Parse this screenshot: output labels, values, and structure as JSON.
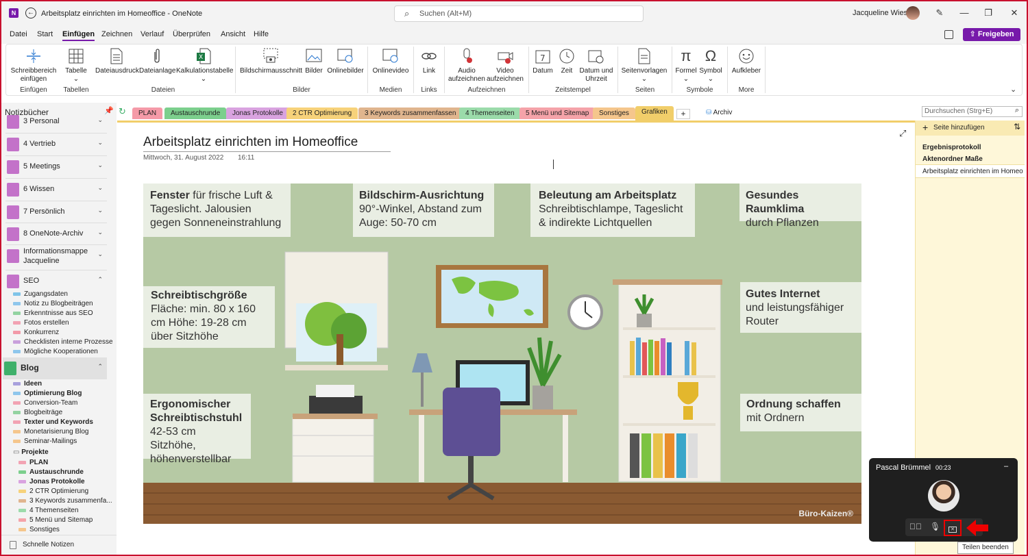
{
  "window": {
    "title": "Arbeitsplatz einrichten im Homeoffice - OneNote",
    "app_icon": "onenote-icon",
    "back_icon": "back-arrow-icon"
  },
  "search": {
    "placeholder": "Suchen (Alt+M)"
  },
  "user": {
    "name": "Jacqueline Wiese"
  },
  "menu": [
    "Datei",
    "Start",
    "Einfügen",
    "Zeichnen",
    "Verlauf",
    "Überprüfen",
    "Ansicht",
    "Hilfe"
  ],
  "menu_active": "Einfügen",
  "share_label": "Freigeben",
  "ribbon": {
    "buttons": [
      "Schreibbereich einfügen",
      "Tabelle",
      "Dateiausdruck",
      "Dateianlage",
      "Kalkulationstabelle",
      "Bildschirmausschnitt",
      "Bilder",
      "Onlinebilder",
      "Onlinevideo",
      "Link",
      "Audio aufzeichnen",
      "Video aufzeichnen",
      "Datum",
      "Zeit",
      "Datum und Uhrzeit",
      "Seitenvorlagen",
      "Formel",
      "Symbol",
      "Aufkleber"
    ],
    "groups": [
      "Einfügen",
      "Tabellen",
      "Dateien",
      "Bilder",
      "Medien",
      "Links",
      "Aufzeichnen",
      "Zeitstempel",
      "Seiten",
      "Symbole",
      "More"
    ]
  },
  "nav": {
    "header": "Notizbücher",
    "notebooks": [
      "3 Personal",
      "4 Vertrieb",
      "5 Meetings",
      "6 Wissen",
      "7 Persönlich",
      "8 OneNote-Archiv",
      "Informationsmappe Jacqueline",
      "SEO"
    ],
    "seo_sections": [
      "Zugangsdaten",
      "Notiz zu Blogbeiträgen",
      "Erkenntnisse aus SEO",
      "Fotos erstellen",
      "Konkurrenz",
      "Checklisten interne Prozesse",
      "Mögliche Kooperationen"
    ],
    "blog": "Blog",
    "blog_sections": [
      "Ideen",
      "Optimierung Blog",
      "Conversion-Team",
      "Blogbeiträge",
      "Texter und Keywords",
      "Monetarisierung Blog",
      "Seminar-Mailings"
    ],
    "projekte": "Projekte",
    "projekte_sections": [
      "PLAN",
      "Austauschrunde",
      "Jonas Protokolle",
      "2 CTR Optimierung",
      "3 Keywords zusammenfa...",
      "4 Themenseiten",
      "5 Menü und Sitemap",
      "Sonstiges"
    ],
    "quick_notes": "Schnelle Notizen"
  },
  "tabs": [
    {
      "label": "PLAN",
      "color": "#f59aa8"
    },
    {
      "label": "Austauschrunde",
      "color": "#7ccf8d"
    },
    {
      "label": "Jonas Protokolle",
      "color": "#d9a3e0"
    },
    {
      "label": "2 CTR Optimierung",
      "color": "#f7d27a"
    },
    {
      "label": "3 Keywords zusammenfassen",
      "color": "#e0b58e"
    },
    {
      "label": "4 Themenseiten",
      "color": "#9bdbaa"
    },
    {
      "label": "5 Menü und Sitemap",
      "color": "#f5a3a9"
    },
    {
      "label": "Sonstiges",
      "color": "#f5c68c"
    },
    {
      "label": "Grafiken",
      "color": "#f1ce6a"
    }
  ],
  "archiv": "Archiv",
  "page_search": "Durchsuchen (Strg+E)",
  "page": {
    "title": "Arbeitsplatz einrichten im Homeoffice",
    "date": "Mittwoch, 31. August 2022",
    "time": "16:11"
  },
  "infographic": {
    "fenster_bold": "Fenster",
    "fenster_text": "für frische Luft & Tageslicht. Jalousien gegen Sonneneinstrahlung",
    "bildschirm_title": "Bildschirm-Ausrichtung",
    "bildschirm_text": "90°-Winkel, Abstand zum Auge: 50-70 cm",
    "beleuchtung_title": "Beleutung am Arbeitsplatz",
    "beleuchtung_text": "Schreibtischlampe, Tageslicht & indirekte Lichtquellen",
    "raumklima_title": "Gesundes Raumklima",
    "raumklima_text": "durch Pflanzen",
    "schreibtisch_title": "Schreibtischgröße",
    "schreibtisch_text": "Fläche: min. 80 x 160 cm Höhe: 19-28 cm über Sitzhöhe",
    "internet_title": "Gutes Internet",
    "internet_text": "und leistungsfähiger Router",
    "stuhl_title": "Ergonomischer Schreibtischstuhl",
    "stuhl_text": "42-53 cm Sitzhöhe, höhenverstellbar",
    "ordnung_title": "Ordnung schaffen",
    "ordnung_text": "mit Ordnern",
    "brand": "Büro-Kaizen®"
  },
  "pages_pane": {
    "add": "Seite hinzufügen",
    "pages": [
      "Ergebnisprotokoll",
      "Aktenordner Maße",
      "Arbeitsplatz einrichten im Homeo"
    ]
  },
  "call": {
    "name": "Pascal Brümmel",
    "duration": "00:23",
    "tooltip": "Teilen beenden"
  }
}
